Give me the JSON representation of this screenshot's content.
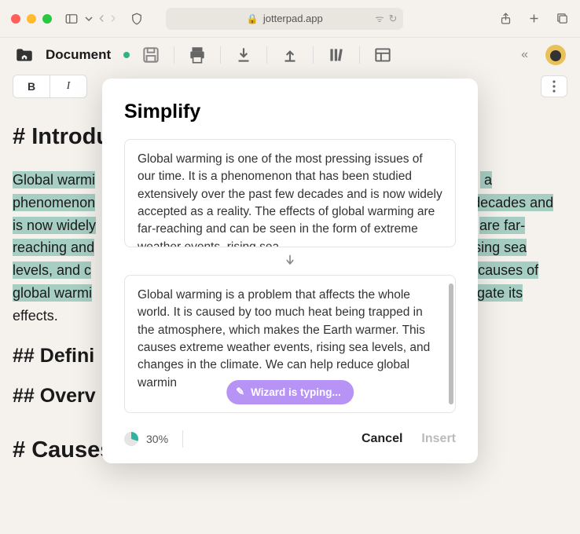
{
  "browser": {
    "url": "jotterpad.app"
  },
  "app": {
    "doc_title": "Document"
  },
  "format": {
    "bold": "B",
    "italic": "I"
  },
  "document": {
    "h1_prefix": "#",
    "h1_text": "Introdu",
    "para_start": "Global warmi",
    "para_line1b": " a",
    "para_line2a": "phenomenon",
    "para_line2b": "decades and",
    "para_line3a": "is now widely",
    "para_line3b": "are far-",
    "para_line4a": "reaching and",
    "para_line4b": "ising sea",
    "para_line5a": "levels, and c",
    "para_line5b": "causes of",
    "para_line6a": "global warmi",
    "para_line6b": "gate its",
    "para_line7": "effects.",
    "h2a_prefix": "##",
    "h2a_text": "Defini",
    "h2b_prefix": "##",
    "h2b_text": "Overv",
    "h1b_prefix": "#",
    "h1b_text": "Causes of Global Warming"
  },
  "modal": {
    "title": "Simplify",
    "input_text": "Global warming is one of the most pressing issues of our time. It is a phenomenon that has been studied extensively over the past few decades and is now widely accepted as a reality. The effects of global warming are far-reaching and can be seen in the form of extreme weather events, rising sea",
    "output_text": "Global warming is a problem that affects the whole world. It is caused by too much heat being trapped in the atmosphere, which makes the Earth warmer. This causes extreme weather events, rising sea levels, and changes in the climate. We can help reduce global warmin",
    "wizard_label": "Wizard is typing...",
    "progress_pct": "30%",
    "cancel_label": "Cancel",
    "insert_label": "Insert"
  }
}
